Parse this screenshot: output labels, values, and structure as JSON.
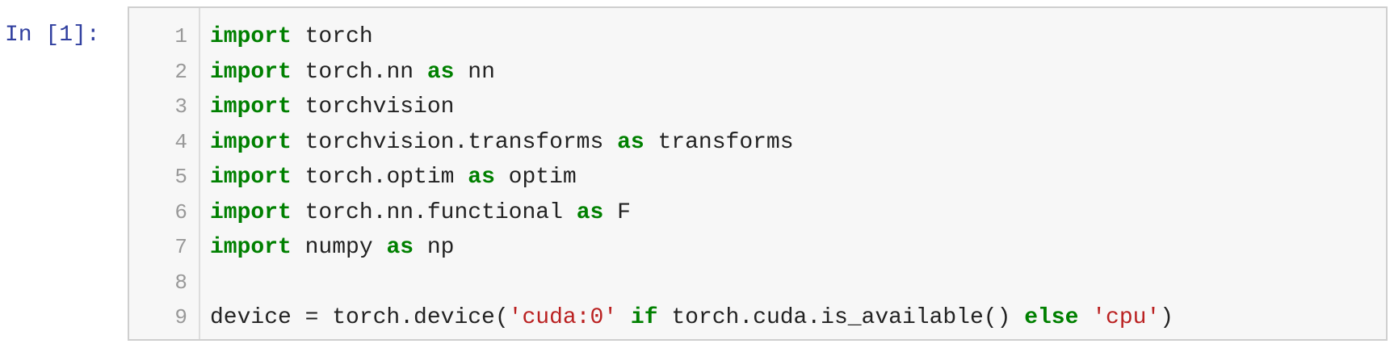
{
  "cell": {
    "prompt": "In [1]:",
    "line_numbers": [
      "1",
      "2",
      "3",
      "4",
      "5",
      "6",
      "7",
      "8",
      "9"
    ],
    "lines": [
      [
        {
          "t": "kw",
          "v": "import"
        },
        {
          "t": "plain",
          "v": " torch"
        }
      ],
      [
        {
          "t": "kw",
          "v": "import"
        },
        {
          "t": "plain",
          "v": " torch.nn "
        },
        {
          "t": "kw",
          "v": "as"
        },
        {
          "t": "plain",
          "v": " nn"
        }
      ],
      [
        {
          "t": "kw",
          "v": "import"
        },
        {
          "t": "plain",
          "v": " torchvision"
        }
      ],
      [
        {
          "t": "kw",
          "v": "import"
        },
        {
          "t": "plain",
          "v": " torchvision.transforms "
        },
        {
          "t": "kw",
          "v": "as"
        },
        {
          "t": "plain",
          "v": " transforms"
        }
      ],
      [
        {
          "t": "kw",
          "v": "import"
        },
        {
          "t": "plain",
          "v": " torch.optim "
        },
        {
          "t": "kw",
          "v": "as"
        },
        {
          "t": "plain",
          "v": " optim"
        }
      ],
      [
        {
          "t": "kw",
          "v": "import"
        },
        {
          "t": "plain",
          "v": " torch.nn.functional "
        },
        {
          "t": "kw",
          "v": "as"
        },
        {
          "t": "plain",
          "v": " F"
        }
      ],
      [
        {
          "t": "kw",
          "v": "import"
        },
        {
          "t": "plain",
          "v": " numpy "
        },
        {
          "t": "kw",
          "v": "as"
        },
        {
          "t": "plain",
          "v": " np"
        }
      ],
      [],
      [
        {
          "t": "plain",
          "v": "device = torch.device("
        },
        {
          "t": "str",
          "v": "'cuda:0'"
        },
        {
          "t": "plain",
          "v": " "
        },
        {
          "t": "kw",
          "v": "if"
        },
        {
          "t": "plain",
          "v": " torch.cuda.is_available() "
        },
        {
          "t": "kw",
          "v": "else"
        },
        {
          "t": "plain",
          "v": " "
        },
        {
          "t": "str",
          "v": "'cpu'"
        },
        {
          "t": "plain",
          "v": ")"
        }
      ]
    ]
  },
  "colors": {
    "prompt": "#303f9f",
    "keyword": "#008000",
    "string": "#ba2121",
    "text": "#222222",
    "line_number": "#999999",
    "editor_background": "#f7f7f7",
    "editor_border": "#cfcfcf"
  }
}
